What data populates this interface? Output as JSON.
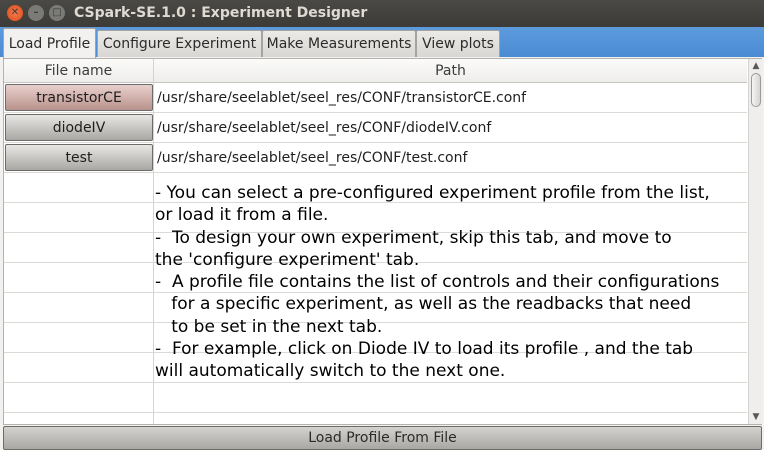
{
  "window": {
    "title": "CSpark-SE.1.0 : Experiment Designer",
    "close_glyph": "✕",
    "min_glyph": "–",
    "max_glyph": "□"
  },
  "tabs": [
    {
      "label": "Load Profile",
      "active": true
    },
    {
      "label": "Configure Experiment",
      "active": false
    },
    {
      "label": "Make Measurements",
      "active": false
    },
    {
      "label": "View plots",
      "active": false
    }
  ],
  "table": {
    "headers": {
      "file_name": "File name",
      "path": "Path"
    },
    "rows": [
      {
        "name": "transistorCE",
        "path": "/usr/share/seelablet/seel_res/CONF/transistorCE.conf"
      },
      {
        "name": "diodeIV",
        "path": "/usr/share/seelablet/seel_res/CONF/diodeIV.conf"
      },
      {
        "name": "test",
        "path": "/usr/share/seelablet/seel_res/CONF/test.conf"
      }
    ],
    "info_text": "- You can select a pre-configured experiment profile from the list,\nor load it from a file.\n-  To design your own experiment, skip this tab, and move to\nthe 'configure experiment' tab.\n-  A profile file contains the list of controls and their configurations\n   for a specific experiment, as well as the readbacks that need\n   to be set in the next tab.\n-  For example, click on Diode IV to load its profile , and the tab\nwill automatically switch to the next one."
  },
  "scrollbar": {
    "up_glyph": "▲",
    "down_glyph": "▼"
  },
  "buttons": {
    "load_profile_from_file": "Load Profile From File"
  },
  "colors": {
    "titlebar": "#3c3b37",
    "tabbar": "#4b8bd3",
    "close_button": "#df4a16",
    "hovered_row_button": "#b9928c"
  }
}
